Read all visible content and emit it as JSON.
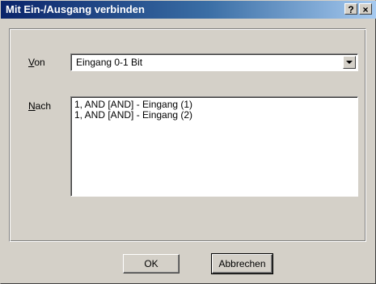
{
  "window": {
    "title": "Mit Ein-/Ausgang verbinden",
    "help_label": "?",
    "close_label": "×"
  },
  "von": {
    "label_mnemonic": "V",
    "label_rest": "on",
    "selected_value": "Eingang 0-1 Bit"
  },
  "nach": {
    "label_mnemonic": "N",
    "label_rest": "ach",
    "items": [
      "1, AND [AND] - Eingang (1)",
      "1, AND [AND] - Eingang (2)"
    ]
  },
  "buttons": {
    "ok_label": "OK",
    "cancel_label": "Abbrechen"
  }
}
